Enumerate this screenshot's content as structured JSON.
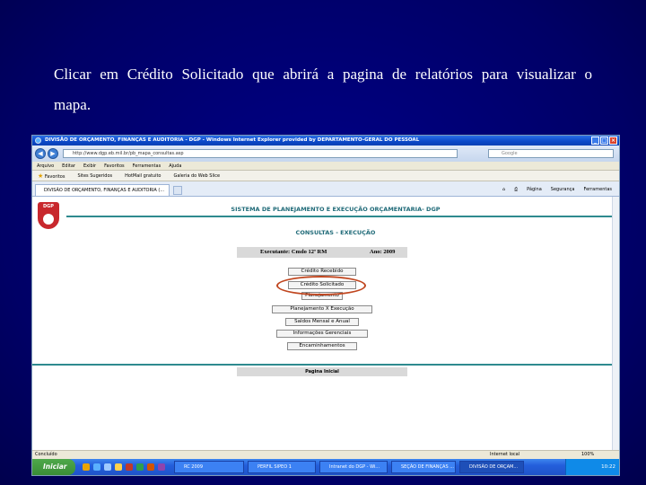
{
  "caption": "Clicar em Crédito Solicitado que abrirá a pagina de relatórios para visualizar o mapa.",
  "browser": {
    "window_title": "DIVISÃO DE ORÇAMENTO, FINANÇAS E AUDITORIA - DGP - Windows Internet Explorer provided by DEPARTAMENTO-GERAL DO PESSOAL",
    "url": "http://www.dgp.eb.mil.br/pb_mapa_consultas.asp",
    "search_placeholder": "Google",
    "menu": [
      "Arquivo",
      "Editar",
      "Exibir",
      "Favoritos",
      "Ferramentas",
      "Ajuda"
    ],
    "favorites": [
      "Favoritos",
      "Sites Sugeridos",
      "HotMail gratuito",
      "Galeria do Web Slice"
    ],
    "tab_label": "DIVISÃO DE ORÇAMENTO, FINANÇAS E AUDITORIA (...",
    "commands": [
      "Página",
      "Segurança",
      "Ferramentas"
    ],
    "status_left": "Concluído",
    "status_zone": "Internet local",
    "zoom": "100%"
  },
  "page": {
    "logo_text": "DGP",
    "system_title": "SISTEMA DE PLANEJAMENTO E EXECUÇÃO ORÇAMENTARIA- DGP",
    "section_title": "CONSULTAS - EXECUÇÃO",
    "executante": "Executante: Cmdo 12ª RM",
    "ano": "Ano: 2009",
    "menu_buttons": [
      "Crédito Recebido",
      "Crédito Solicitado",
      "Planejamento",
      "Planejamento X Execução",
      "Saldos Mensal e Anual",
      "Informações Gerenciais",
      "Encaminhamentos"
    ],
    "highlighted_button": "Crédito Solicitado",
    "home_link": "Pagina Inicial"
  },
  "taskbar": {
    "start_label": "Iniciar",
    "tasks": [
      "RC 2009",
      "PERFIL SIPEO 1",
      "Intranet do DGP - Wi...",
      "SEÇÃO DE FINANÇAS ...",
      "DIVISÃO DE ORÇAM..."
    ],
    "clock": "10:22"
  },
  "colors": {
    "slide_background": "#000080",
    "highlight_ring": "#c0461f",
    "page_heading": "#1f6a78"
  }
}
